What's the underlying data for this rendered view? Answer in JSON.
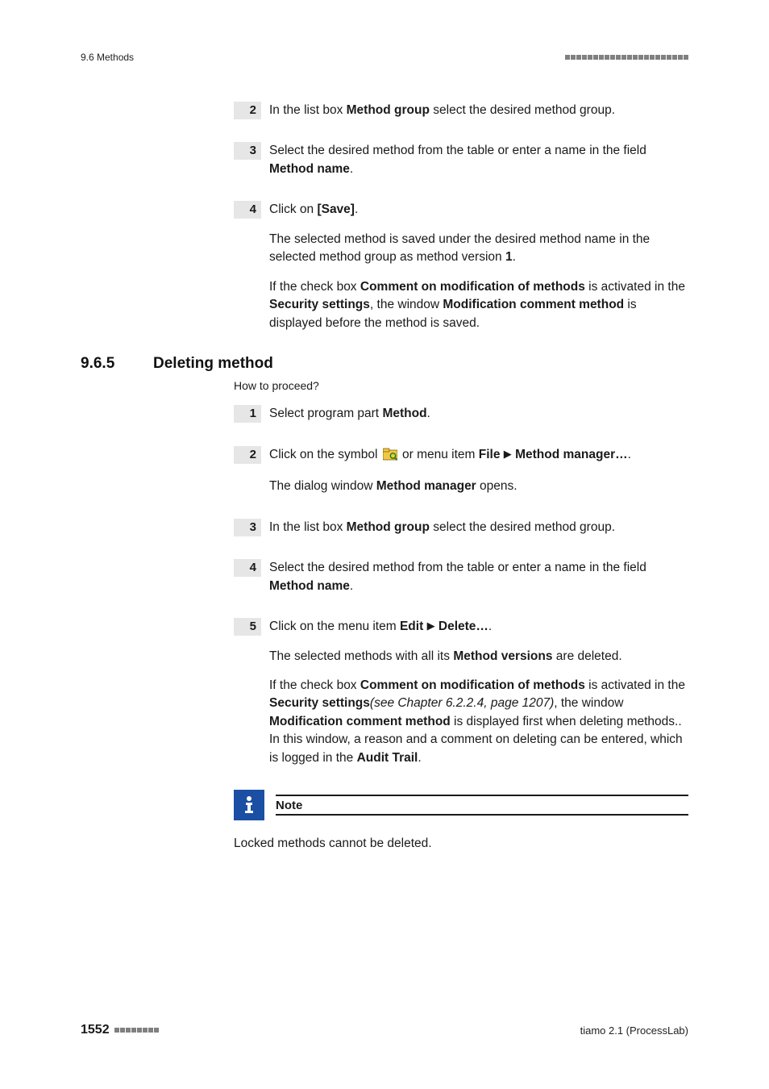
{
  "header": {
    "section_ref": "9.6 Methods"
  },
  "steps_a": [
    {
      "num": "2",
      "paras": [
        [
          {
            "t": "In the list box "
          },
          {
            "t": "Method group",
            "b": true
          },
          {
            "t": " select the desired method group."
          }
        ]
      ]
    },
    {
      "num": "3",
      "paras": [
        [
          {
            "t": "Select the desired method from the table or enter a name in the field "
          },
          {
            "t": "Method name",
            "b": true
          },
          {
            "t": "."
          }
        ]
      ]
    },
    {
      "num": "4",
      "paras": [
        [
          {
            "t": "Click on "
          },
          {
            "t": "[Save]",
            "b": true
          },
          {
            "t": "."
          }
        ],
        [
          {
            "t": "The selected method is saved under the desired method name in the selected method group as method version "
          },
          {
            "t": "1",
            "b": true
          },
          {
            "t": "."
          }
        ],
        [
          {
            "t": "If the check box "
          },
          {
            "t": "Comment on modification of methods",
            "b": true
          },
          {
            "t": " is activated in the "
          },
          {
            "t": "Security settings",
            "b": true
          },
          {
            "t": ", the window "
          },
          {
            "t": "Modification comment method",
            "b": true
          },
          {
            "t": " is displayed before the method is saved."
          }
        ]
      ]
    }
  ],
  "section": {
    "num": "9.6.5",
    "title": "Deleting method",
    "how_to": "How to proceed?"
  },
  "steps_b": [
    {
      "num": "1",
      "paras": [
        [
          {
            "t": "Select program part "
          },
          {
            "t": "Method",
            "b": true
          },
          {
            "t": "."
          }
        ]
      ]
    },
    {
      "num": "2",
      "icon": true,
      "paras": [
        [
          {
            "t": "Click on the symbol "
          },
          {
            "icon": true
          },
          {
            "t": " or menu item "
          },
          {
            "t": "File",
            "b": true
          },
          {
            "t": " "
          },
          {
            "arrow": true
          },
          {
            "t": " "
          },
          {
            "t": "Method manager…",
            "b": true
          },
          {
            "t": "."
          }
        ],
        [
          {
            "t": "The dialog window "
          },
          {
            "t": "Method manager",
            "b": true
          },
          {
            "t": " opens."
          }
        ]
      ]
    },
    {
      "num": "3",
      "paras": [
        [
          {
            "t": "In the list box "
          },
          {
            "t": "Method group",
            "b": true
          },
          {
            "t": " select the desired method group."
          }
        ]
      ]
    },
    {
      "num": "4",
      "paras": [
        [
          {
            "t": "Select the desired method from the table or enter a name in the field "
          },
          {
            "t": "Method name",
            "b": true
          },
          {
            "t": "."
          }
        ]
      ]
    },
    {
      "num": "5",
      "paras": [
        [
          {
            "t": "Click on the menu item "
          },
          {
            "t": "Edit",
            "b": true
          },
          {
            "t": " "
          },
          {
            "arrow": true
          },
          {
            "t": " "
          },
          {
            "t": "Delete…",
            "b": true
          },
          {
            "t": "."
          }
        ],
        [
          {
            "t": "The selected methods with all its "
          },
          {
            "t": "Method versions",
            "b": true
          },
          {
            "t": " are deleted."
          }
        ],
        [
          {
            "t": "If the check box "
          },
          {
            "t": "Comment on modification of methods",
            "b": true
          },
          {
            "t": " is activated in the "
          },
          {
            "t": "Security settings",
            "b": true
          },
          {
            "t": "(see Chapter 6.2.2.4, page 1207)",
            "i": true
          },
          {
            "t": ", the window "
          },
          {
            "t": "Modification comment method",
            "b": true
          },
          {
            "t": " is displayed first when deleting methods.. In this window, a reason and a comment on deleting can be entered, which is logged in the "
          },
          {
            "t": "Audit Trail",
            "b": true
          },
          {
            "t": "."
          }
        ]
      ]
    }
  ],
  "note": {
    "title": "Note",
    "body": "Locked methods cannot be deleted."
  },
  "footer": {
    "page": "1552",
    "product": "tiamo 2.1 (ProcessLab)"
  }
}
